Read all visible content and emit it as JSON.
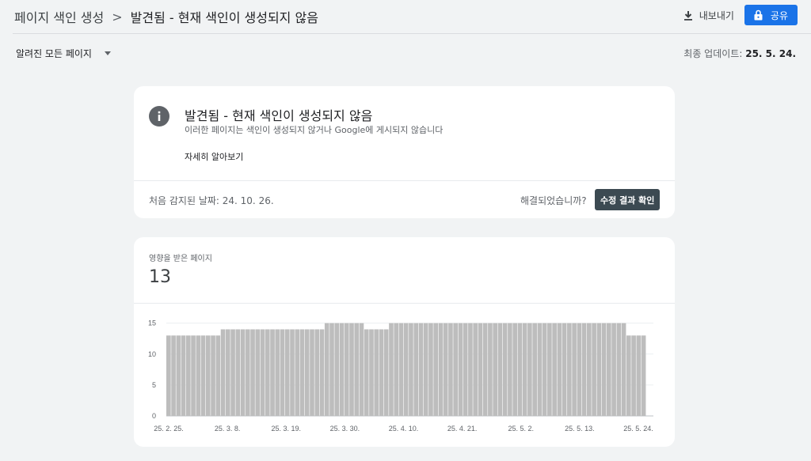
{
  "breadcrumb": {
    "parent": "페이지 색인 생성",
    "separator": ">",
    "current": "발견됨 - 현재 색인이 생성되지 않음"
  },
  "actions": {
    "export_label": "내보내기",
    "share_label": "공유"
  },
  "filter": {
    "selected": "알려진 모든 페이지"
  },
  "updated": {
    "label": "최종 업데이트:",
    "date": "25. 5. 24."
  },
  "issue": {
    "title": "발견됨 - 현재 색인이 생성되지 않음",
    "subtitle": "이러한 페이지는 색인이 생성되지 않거나 Google에 게시되지 않습니다",
    "learn_more": "자세히 알아보기",
    "first_detected": "처음 감지된 날짜: 24. 10. 26.",
    "resolved_question": "해결되었습니까?",
    "validate_label": "수정 결과 확인"
  },
  "affected": {
    "label": "영향을 받은 페이지",
    "value": "13"
  },
  "colors": {
    "accent": "#1a73e8",
    "bar": "#bdbdbd",
    "validate_bg": "#3c4a52"
  },
  "chart_data": {
    "type": "bar",
    "y_ticks": [
      "0",
      "5",
      "10",
      "15"
    ],
    "ylim": [
      0,
      17
    ],
    "grid": true,
    "x_tick_labels": [
      "25. 2. 25.",
      "25. 3. 8.",
      "25. 3. 19.",
      "25. 3. 30.",
      "25. 4. 10.",
      "25. 4. 21.",
      "25. 5. 2.",
      "25. 5. 13.",
      "25. 5. 24."
    ],
    "values": [
      13,
      13,
      13,
      13,
      13,
      13,
      13,
      13,
      13,
      13,
      13,
      14,
      14,
      14,
      14,
      14,
      14,
      14,
      14,
      14,
      14,
      14,
      14,
      14,
      14,
      14,
      14,
      14,
      14,
      14,
      14,
      14,
      15,
      15,
      15,
      15,
      15,
      15,
      15,
      15,
      14,
      14,
      14,
      14,
      14,
      15,
      15,
      15,
      15,
      15,
      15,
      15,
      15,
      15,
      15,
      15,
      15,
      15,
      15,
      15,
      15,
      15,
      15,
      15,
      15,
      15,
      15,
      15,
      15,
      15,
      15,
      15,
      15,
      15,
      15,
      15,
      15,
      15,
      15,
      15,
      15,
      15,
      15,
      15,
      15,
      15,
      15,
      15,
      15,
      15,
      15,
      15,
      15,
      13,
      13,
      13,
      13
    ]
  }
}
